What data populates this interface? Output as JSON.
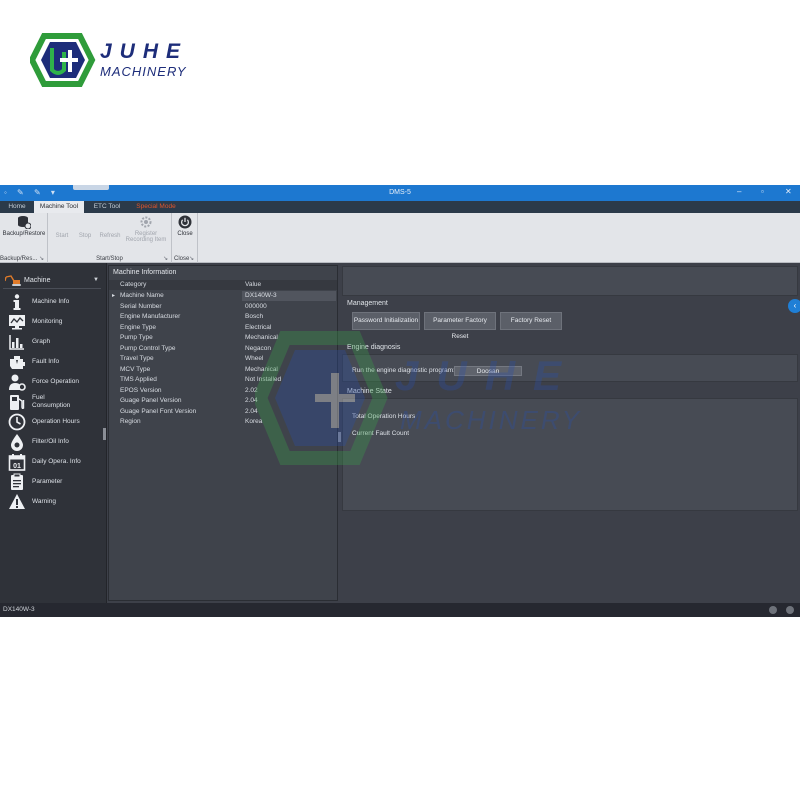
{
  "brand": {
    "line1": "JUHE",
    "line2": "MACHINERY"
  },
  "window": {
    "title": "DMS-5",
    "minimize": "–",
    "restore": "▫",
    "close": "✕"
  },
  "tabs": [
    {
      "label": "Home"
    },
    {
      "label": "Machine Tool"
    },
    {
      "label": "ETC Tool"
    },
    {
      "label": "Special Mode"
    }
  ],
  "ribbon": {
    "backup": {
      "label": "Backup/Restore",
      "group": "Backup/Res..."
    },
    "start": {
      "label": "Start"
    },
    "stop": {
      "label": "Stop"
    },
    "refresh": {
      "label": "Refresh"
    },
    "register": {
      "label1": "Register",
      "label2": "Recording Item"
    },
    "startstop_group": "Start/Stop",
    "close": {
      "label": "Close",
      "group": "Close"
    }
  },
  "nav": {
    "header": "Machine",
    "items": [
      {
        "label": "Machine Info"
      },
      {
        "label": "Monitoring"
      },
      {
        "label": "Graph"
      },
      {
        "label": "Fault Info"
      },
      {
        "label": "Force Operation"
      },
      {
        "label": "Fuel",
        "label2": "Consumption"
      },
      {
        "label": "Operation Hours"
      },
      {
        "label": "Filter/Oil Info"
      },
      {
        "label": "Daily Opera. Info"
      },
      {
        "label": "Parameter"
      },
      {
        "label": "Warning"
      }
    ],
    "calendar_day": "01"
  },
  "machine_info": {
    "title": "Machine Information",
    "col_category": "Category",
    "col_value": "Value",
    "rows": [
      {
        "category": "Machine Name",
        "value": "DX140W-3"
      },
      {
        "category": "Serial Number",
        "value": "000000"
      },
      {
        "category": "Engine Manufacturer",
        "value": "Bosch"
      },
      {
        "category": "Engine Type",
        "value": "Electrical"
      },
      {
        "category": "Pump Type",
        "value": "Mechanical"
      },
      {
        "category": "Pump Control Type",
        "value": "Negacon"
      },
      {
        "category": "Travel Type",
        "value": "Wheel"
      },
      {
        "category": "MCV Type",
        "value": "Mechanical"
      },
      {
        "category": "TMS Applied",
        "value": "Not Installed"
      },
      {
        "category": "EPOS Version",
        "value": "2.02"
      },
      {
        "category": "Guage Panel Version",
        "value": "2.04"
      },
      {
        "category": "Guage Panel Font Version",
        "value": "2.04"
      },
      {
        "category": "Region",
        "value": "Korea"
      }
    ]
  },
  "management": {
    "title": "Management",
    "password_init": "Password Initialization",
    "param_reset": "Parameter Factory Reset",
    "factory_reset": "Factory Reset"
  },
  "engine_diag": {
    "title": "Engine diagnosis",
    "label": "Run the engine diagnostic program:",
    "program": "Doosan"
  },
  "machine_state": {
    "title": "Machine State",
    "total_hours": "Total Operation Hours",
    "fault_count": "Current Fault Count"
  },
  "status": {
    "model": "DX140W-3"
  },
  "colors": {
    "titlebar": "#1d78d0",
    "special_mode": "#e0552c",
    "accent": "#1f7fd6"
  }
}
